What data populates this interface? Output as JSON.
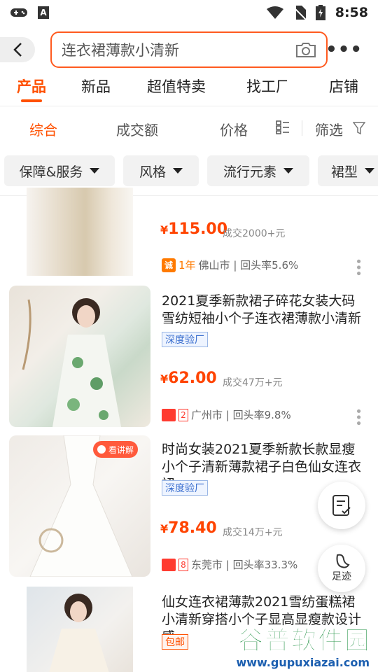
{
  "status_bar": {
    "time": "8:58"
  },
  "search": {
    "query": "连衣裙薄款小清新"
  },
  "tabs": [
    "产品",
    "新品",
    "超值特卖",
    "找工厂",
    "店铺"
  ],
  "sort": {
    "items": [
      "综合",
      "成交额",
      "价格"
    ],
    "filter_label": "筛选"
  },
  "chips": [
    "保障&服务",
    "风格",
    "流行元素",
    "裙型"
  ],
  "products": [
    {
      "price_yen": "¥",
      "price_num": "115.00",
      "sold": "成交2000+元",
      "years": "1年",
      "city_stats": "佛山市 | 回头率5.6%"
    },
    {
      "title": "2021夏季新款裙子碎花女装大码雪纺短袖小个子连衣裙薄款小清新",
      "badge": "深度验厂",
      "price_yen": "¥",
      "price_num": "62.00",
      "sold": "成交47万+元",
      "level": "2",
      "city_stats": "广州市 | 回头率9.8%"
    },
    {
      "title": "时尚女装2021夏季新款长款显瘦小个子清新薄款裙子白色仙女连衣裙",
      "badge": "深度验厂",
      "price_yen": "¥",
      "price_num": "78.40",
      "sold": "成交14万+元",
      "level": "8",
      "city_stats": "东莞市 | 回头率33.3%",
      "thumb_tag": "看讲解"
    },
    {
      "title": "仙女连衣裙薄款2021雪纺蛋糕裙小清新穿搭小个子显高显瘦款设计感",
      "badge": "包邮"
    }
  ],
  "fabs": {
    "track_label": "足迹"
  },
  "watermark": {
    "main": "谷普软件园",
    "sub": "www.gupuxiazai.com"
  },
  "colors": {
    "accent": "#ff5000",
    "price": "#ff4400"
  }
}
